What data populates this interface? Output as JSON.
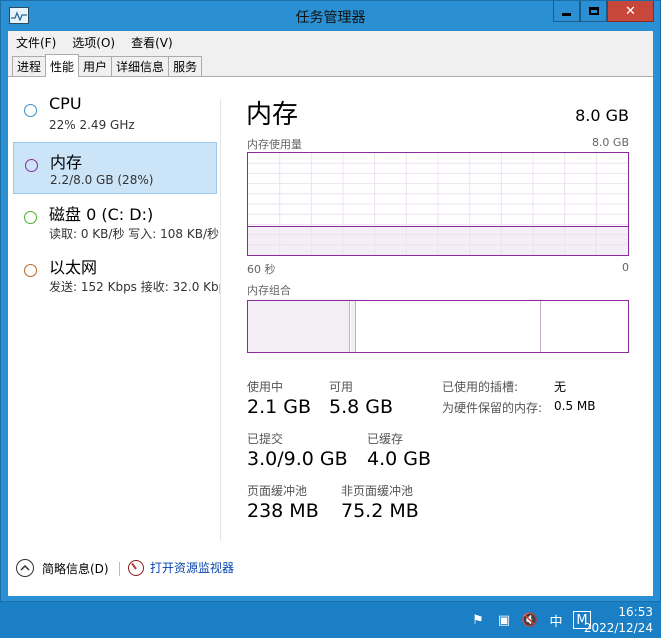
{
  "window": {
    "title": "任务管理器"
  },
  "menu": [
    "文件(F)",
    "选项(O)",
    "查看(V)"
  ],
  "tabs": [
    "进程",
    "性能",
    "用户",
    "详细信息",
    "服务"
  ],
  "devices": [
    {
      "name": "CPU",
      "sub": "22% 2.49 GHz",
      "color": "#3a8fc2"
    },
    {
      "name": "内存",
      "sub": "2.2/8.0 GB (28%)",
      "color": "#8b2a9b"
    },
    {
      "name": "磁盘 0 (C: D:)",
      "sub": "读取: 0 KB/秒  写入: 108 KB/秒",
      "color": "#4caf29"
    },
    {
      "name": "以太网",
      "sub": "发送: 152 Kbps  接收: 32.0 Kbps",
      "color": "#b8662a"
    }
  ],
  "detail": {
    "title": "内存",
    "total": "8.0 GB",
    "usage_label": "内存使用量",
    "usage_max": "8.0 GB",
    "time_left": "60 秒",
    "time_right": "0",
    "composition_label": "内存组合",
    "usage_fraction": 0.28
  },
  "stats": {
    "in_use_label": "使用中",
    "in_use": "2.1 GB",
    "available_label": "可用",
    "available": "5.8 GB",
    "slots_label": "已使用的插槽:",
    "slots": "无",
    "reserved_label": "为硬件保留的内存:",
    "reserved": "0.5 MB",
    "committed_label": "已提交",
    "committed": "3.0/9.0 GB",
    "cached_label": "已缓存",
    "cached": "4.0 GB",
    "paged_label": "页面缓冲池",
    "paged": "238 MB",
    "nonpaged_label": "非页面缓冲池",
    "nonpaged": "75.2 MB"
  },
  "footer": {
    "brief": "简略信息(D)",
    "monitor": "打开资源监视器"
  },
  "taskbar": {
    "ime": "中",
    "ime2": "M",
    "time": "16:53",
    "date": "2022/12/24"
  }
}
